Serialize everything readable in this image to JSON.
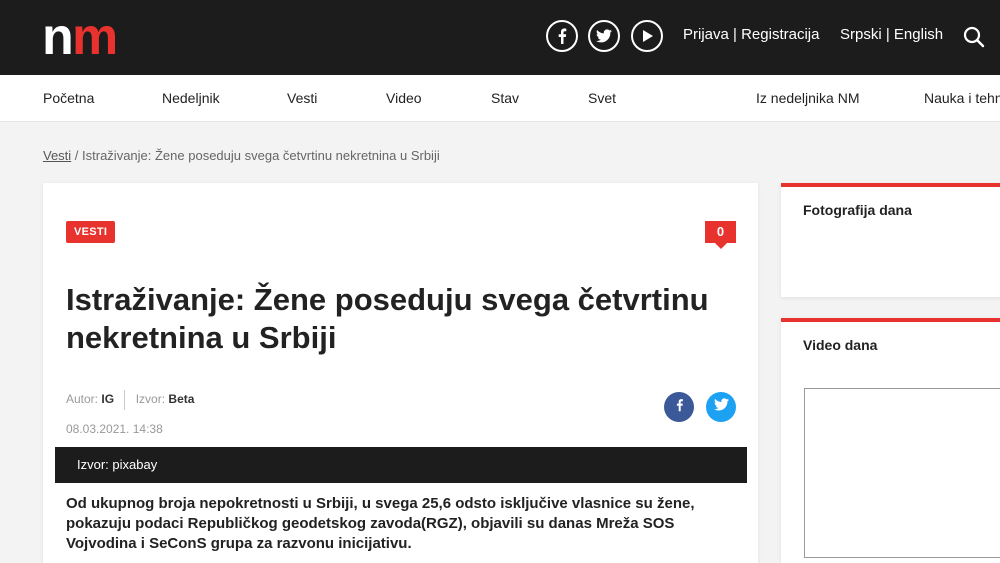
{
  "header": {
    "logo_text": "nm",
    "social": [
      "facebook-icon",
      "twitter-icon",
      "youtube-icon"
    ],
    "login": "Prijava",
    "auth_separator": " | ",
    "register": "Registracija",
    "lang_sr": "Srpski",
    "lang_separator": " | ",
    "lang_en": "English",
    "brand_color": "#e8322d"
  },
  "nav": {
    "items": [
      "Početna",
      "Nedeljnik",
      "Vesti",
      "Video",
      "Stav",
      "Svet",
      "Iz nedeljnika NM",
      "Nauka i tehn"
    ]
  },
  "breadcrumb": {
    "link": "Vesti",
    "current": " / Istraživanje: Žene poseduju svega četvrtinu nekretnina u Srbiji"
  },
  "article": {
    "category": "VESTI",
    "comments": "0",
    "title": "Istraživanje: Žene poseduju svega četvrtinu nekretnina u Srbiji",
    "author_label": "Autor:",
    "author": "IG",
    "source_label": "Izvor:",
    "source": "Beta",
    "date": "08.03.2021. 14:38",
    "photo_source": "Izvor: pixabay",
    "lead": "Od ukupnog broja nepokretnosti u Srbiji, u svega 25,6 odsto isključive vlasnice su žene, pokazuju podaci Republičkog geodetskog zavoda(RGZ), objavili su danas Mreža SOS Vojvodina i SeConS grupa za razvonu inicijativu."
  },
  "sidebar": {
    "photo_title": "Fotografija dana",
    "video_title": "Video dana"
  }
}
